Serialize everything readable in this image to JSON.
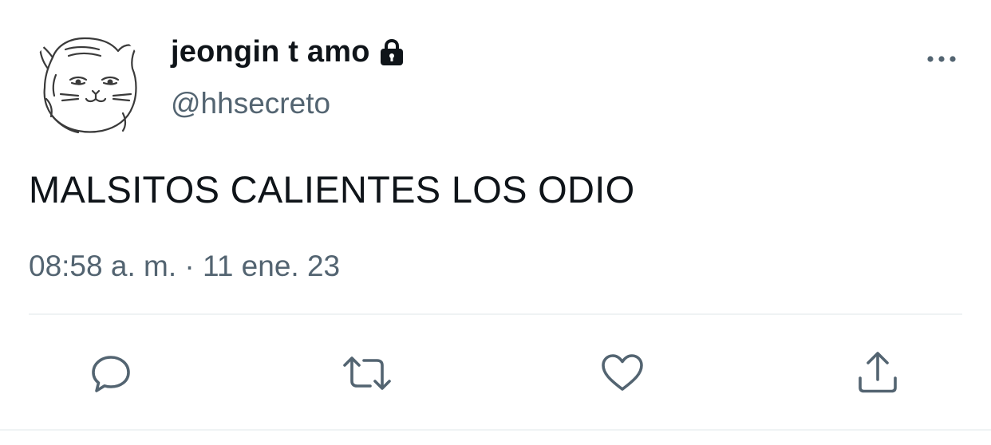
{
  "tweet": {
    "author": {
      "display_name": "jeongin t amo",
      "handle": "@hhsecreto",
      "protected": true,
      "avatar_icon": "cartoon-cat-avatar"
    },
    "text": "MALSITOS CALIENTES LOS ODIO",
    "timestamp": "08:58 a. m. · 11 ene. 23",
    "more_icon": "more-horizontal-icon",
    "actions": [
      {
        "name": "reply",
        "icon": "reply-icon"
      },
      {
        "name": "retweet",
        "icon": "retweet-icon"
      },
      {
        "name": "like",
        "icon": "heart-icon"
      },
      {
        "name": "share",
        "icon": "share-icon"
      }
    ]
  },
  "colors": {
    "primary_text": "#0f1419",
    "secondary_text": "#536471",
    "divider": "#eff3f4",
    "icon": "#536471"
  }
}
